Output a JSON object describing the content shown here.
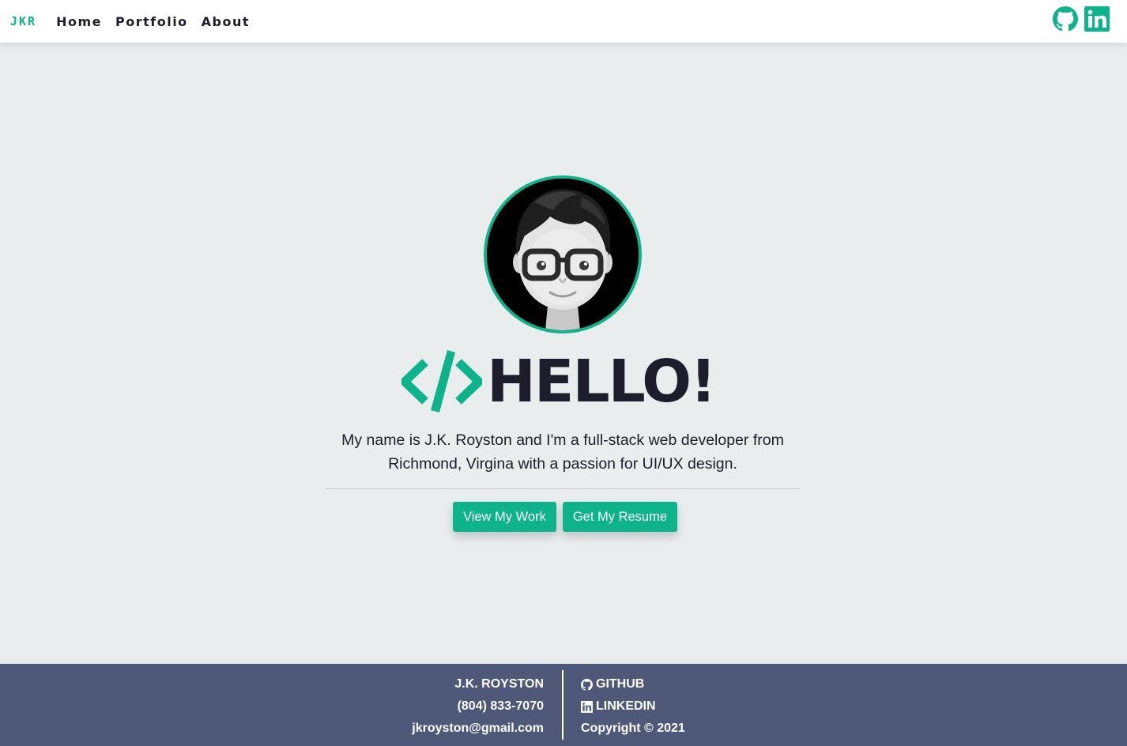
{
  "navbar": {
    "brand": "JKR",
    "links": [
      "Home",
      "Portfolio",
      "About"
    ],
    "icons": [
      "github-icon",
      "linkedin-icon"
    ],
    "accent": "#0db38a"
  },
  "hero": {
    "avatar_icon": "memoji-avatar",
    "code_icon": "code-brackets-icon",
    "heading": "HELLO!",
    "intro_line1": "My name is J.K. Royston and I'm a full-stack web developer from",
    "intro_line2": "Richmond, Virgina with a passion for UI/UX design.",
    "buttons": [
      "View My Work",
      "Get My Resume"
    ]
  },
  "footer": {
    "name": "J.K. ROYSTON",
    "phone": "(804) 833-7070",
    "email": "jkroyston@gmail.com",
    "github_label": "GITHUB",
    "linkedin_label": "LINKEDIN",
    "copyright": "Copyright © 2021",
    "background": "#4f5879"
  }
}
